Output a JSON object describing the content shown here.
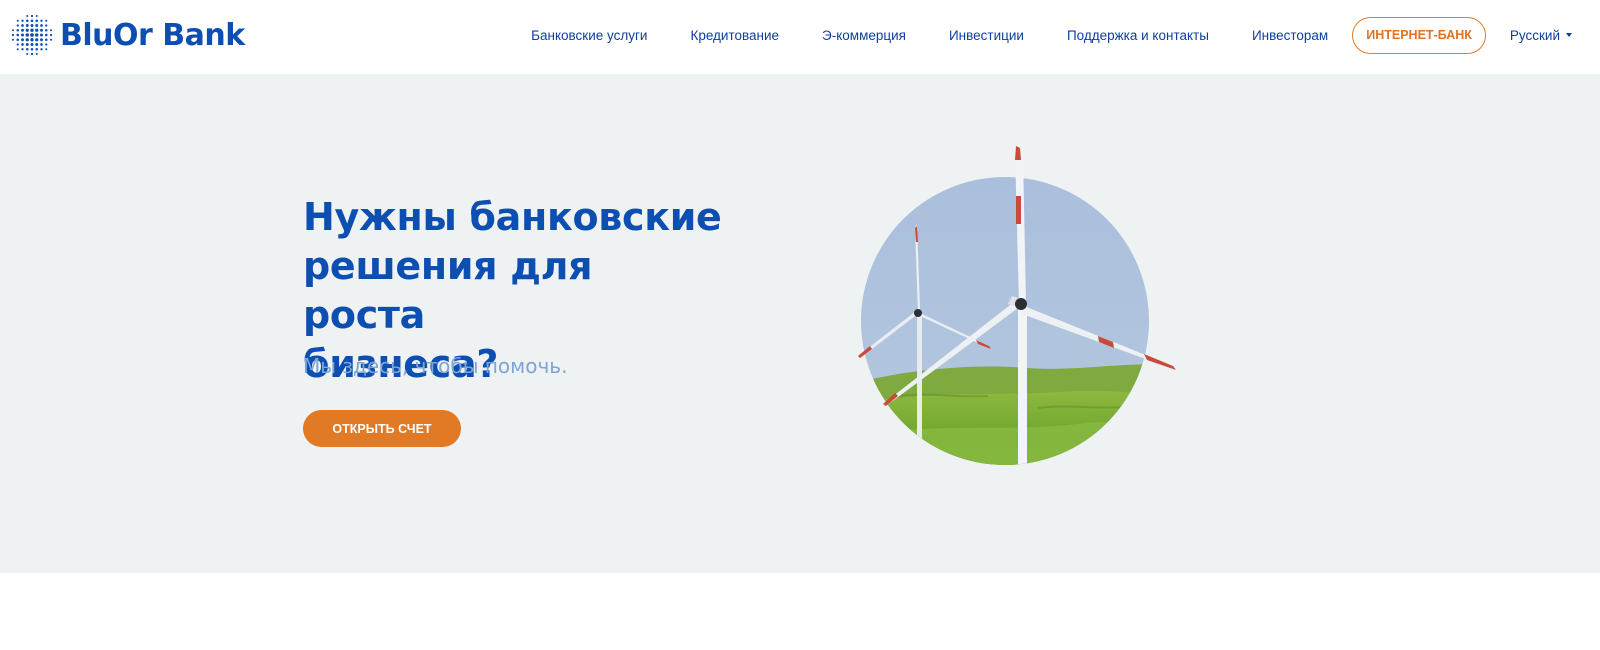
{
  "brand": {
    "name": "BluOr Bank",
    "color": "#0d4fb0"
  },
  "nav": {
    "items": [
      {
        "label": "Банковские услуги"
      },
      {
        "label": "Кредитование"
      },
      {
        "label": "Э-коммерция"
      },
      {
        "label": "Инвестиции"
      },
      {
        "label": "Поддержка и контакты"
      },
      {
        "label": "Инвесторам"
      }
    ],
    "online_bank_label": "ИНТЕРНЕТ-БАНК",
    "language": "Русский"
  },
  "hero": {
    "title": "Нужны банковские решения для роста бизнеса?",
    "subtitle": "Мы здесь, чтобы помочь.",
    "cta_label": "ОТКРЫТЬ СЧЕТ",
    "image_subject": "wind-turbines-on-green-hills"
  },
  "colors": {
    "accent": "#e27a25",
    "primary": "#0d4fb0",
    "hero_bg": "#eff2f3",
    "subtitle": "#7ea4d8"
  }
}
